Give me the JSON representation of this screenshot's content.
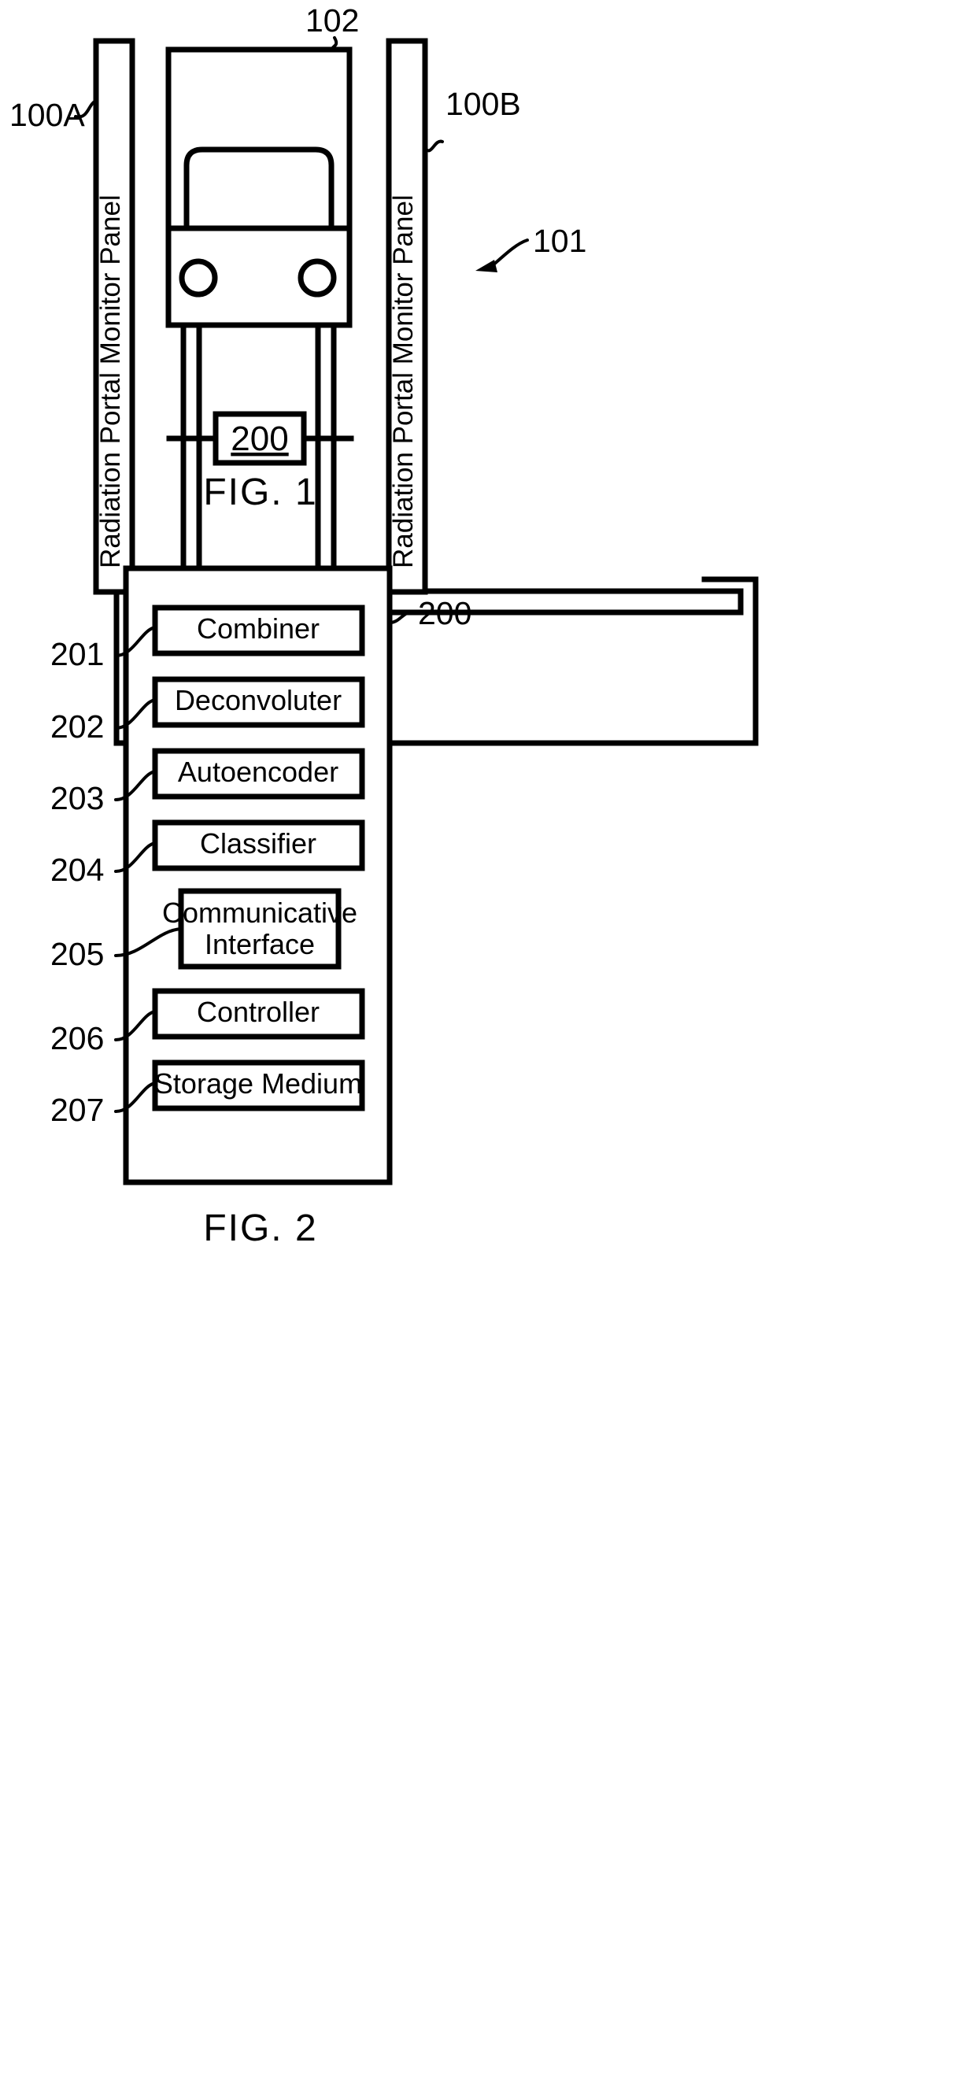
{
  "document": {
    "type": "patent-drawing-sheet",
    "figures": [
      {
        "id": "fig1",
        "caption": "FIG. 1",
        "reference_numerals": {
          "system": "101",
          "vehicle": "102",
          "panel_left": "100A",
          "panel_right": "100B",
          "controller_box": "200"
        },
        "panels": {
          "left_label": "Radiation Portal Monitor Panel",
          "right_label": "Radiation Portal Monitor Panel"
        }
      },
      {
        "id": "fig2",
        "caption": "FIG. 2",
        "outer_box_numeral": "200",
        "blocks": [
          {
            "numeral": "201",
            "label": "Combiner",
            "lines": [
              "Combiner"
            ]
          },
          {
            "numeral": "202",
            "label": "Deconvoluter",
            "lines": [
              "Deconvoluter"
            ]
          },
          {
            "numeral": "203",
            "label": "Autoencoder",
            "lines": [
              "Autoencoder"
            ]
          },
          {
            "numeral": "204",
            "label": "Classifier",
            "lines": [
              "Classifier"
            ]
          },
          {
            "numeral": "205",
            "label": "Communicative Interface",
            "lines": [
              "Communicative",
              "Interface"
            ]
          },
          {
            "numeral": "206",
            "label": "Controller",
            "lines": [
              "Controller"
            ]
          },
          {
            "numeral": "207",
            "label": "Storage Medium",
            "lines": [
              "Storage Medium"
            ]
          }
        ]
      }
    ],
    "colors": {
      "ink": "#000000",
      "paper": "#ffffff"
    }
  }
}
